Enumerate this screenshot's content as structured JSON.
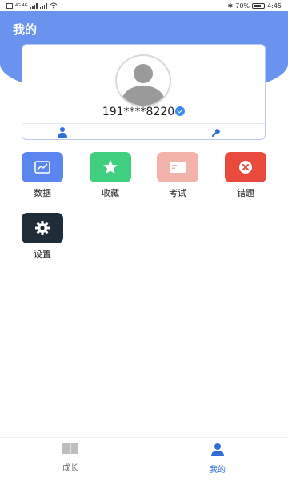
{
  "status_bar": {
    "left_indicators": "4G 4G",
    "battery": "70%",
    "time": "4:45"
  },
  "header": {
    "title": "我的"
  },
  "profile": {
    "phone": "191****8220"
  },
  "features": [
    {
      "label": "数据",
      "icon": "chart-icon",
      "color": "#5b86f0"
    },
    {
      "label": "收藏",
      "icon": "star-icon",
      "color": "#3fcf7e"
    },
    {
      "label": "考试",
      "icon": "exam-card-icon",
      "color": "#f3b3aa"
    },
    {
      "label": "错题",
      "icon": "close-circle-icon",
      "color": "#e84a3e"
    },
    {
      "label": "设置",
      "icon": "gear-icon",
      "color": "#1f2d3a"
    }
  ],
  "bottom_nav": [
    {
      "label": "成长",
      "icon": "book-icon",
      "active": false
    },
    {
      "label": "我的",
      "icon": "person-icon",
      "active": true
    }
  ],
  "colors": {
    "accent": "#2f6fd8",
    "header": "#6a93ef",
    "inactive": "#999999"
  }
}
